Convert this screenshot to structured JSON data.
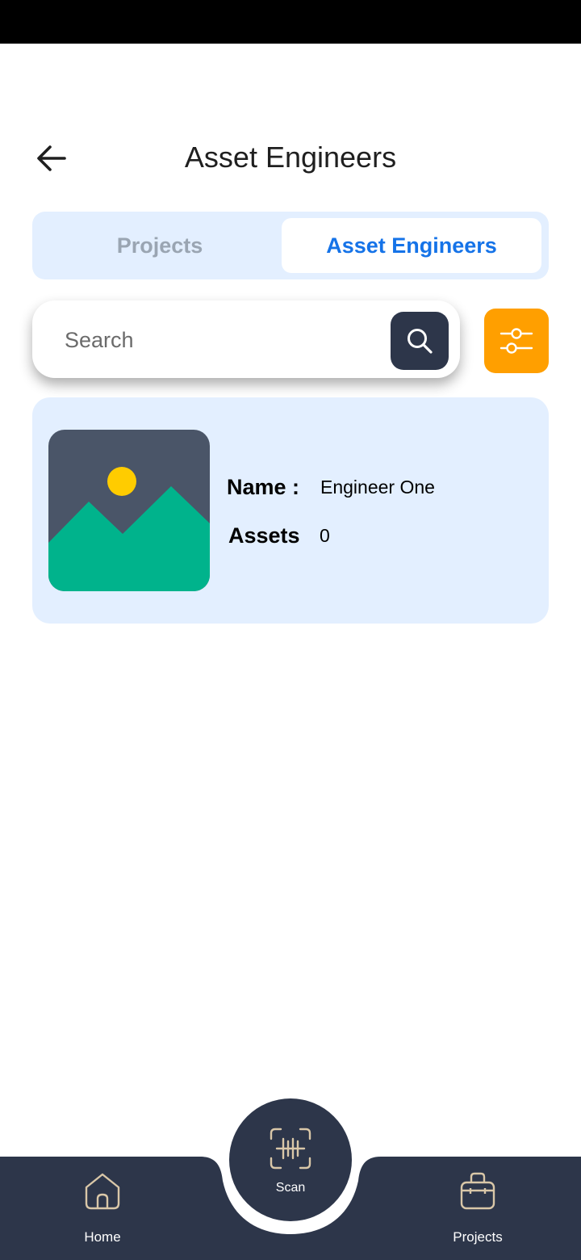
{
  "header": {
    "title": "Asset Engineers"
  },
  "tabs": [
    {
      "label": "Projects",
      "active": false
    },
    {
      "label": "Asset Engineers",
      "active": true
    }
  ],
  "search": {
    "placeholder": "Search",
    "value": ""
  },
  "engineers": [
    {
      "name_label": "Name :",
      "name": "Engineer One",
      "assets_label": "Assets",
      "assets": "0"
    }
  ],
  "nav": {
    "home": "Home",
    "scan": "Scan",
    "projects": "Projects"
  },
  "colors": {
    "accent": "#1573e8",
    "dark": "#2d364a",
    "filter": "#ff9f00",
    "panel": "#e3efff"
  },
  "icons": {
    "back": "arrow-left-icon",
    "search": "search-icon",
    "filter": "sliders-icon",
    "home": "home-icon",
    "scan": "barcode-scan-icon",
    "projects": "toolbox-icon"
  }
}
